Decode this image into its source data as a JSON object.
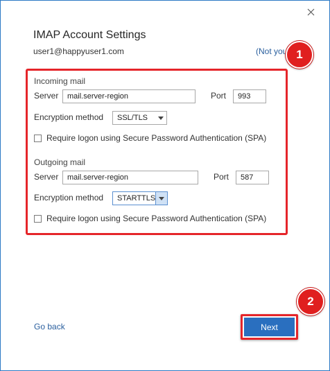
{
  "dialog": {
    "title": "IMAP Account Settings",
    "email": "user1@happyuser1.com",
    "not_you_link": "(Not you?)"
  },
  "incoming": {
    "section_label": "Incoming mail",
    "server_label": "Server",
    "server_value": "mail.server-region",
    "port_label": "Port",
    "port_value": "993",
    "encryption_label": "Encryption method",
    "encryption_value": "SSL/TLS",
    "spa_label": "Require logon using Secure Password Authentication (SPA)",
    "spa_checked": false
  },
  "outgoing": {
    "section_label": "Outgoing mail",
    "server_label": "Server",
    "server_value": "mail.server-region",
    "port_label": "Port",
    "port_value": "587",
    "encryption_label": "Encryption method",
    "encryption_value": "STARTTLS",
    "spa_label": "Require logon using Secure Password Authentication (SPA)",
    "spa_checked": false
  },
  "annotations": {
    "step1": "1",
    "step2": "2",
    "highlight_color": "#e5252a"
  },
  "footer": {
    "go_back": "Go back",
    "next": "Next"
  },
  "colors": {
    "accent": "#2a6fbf",
    "link": "#2a5f9e"
  },
  "icons": {
    "close": "close-icon",
    "dropdown": "chevron-down-icon"
  }
}
